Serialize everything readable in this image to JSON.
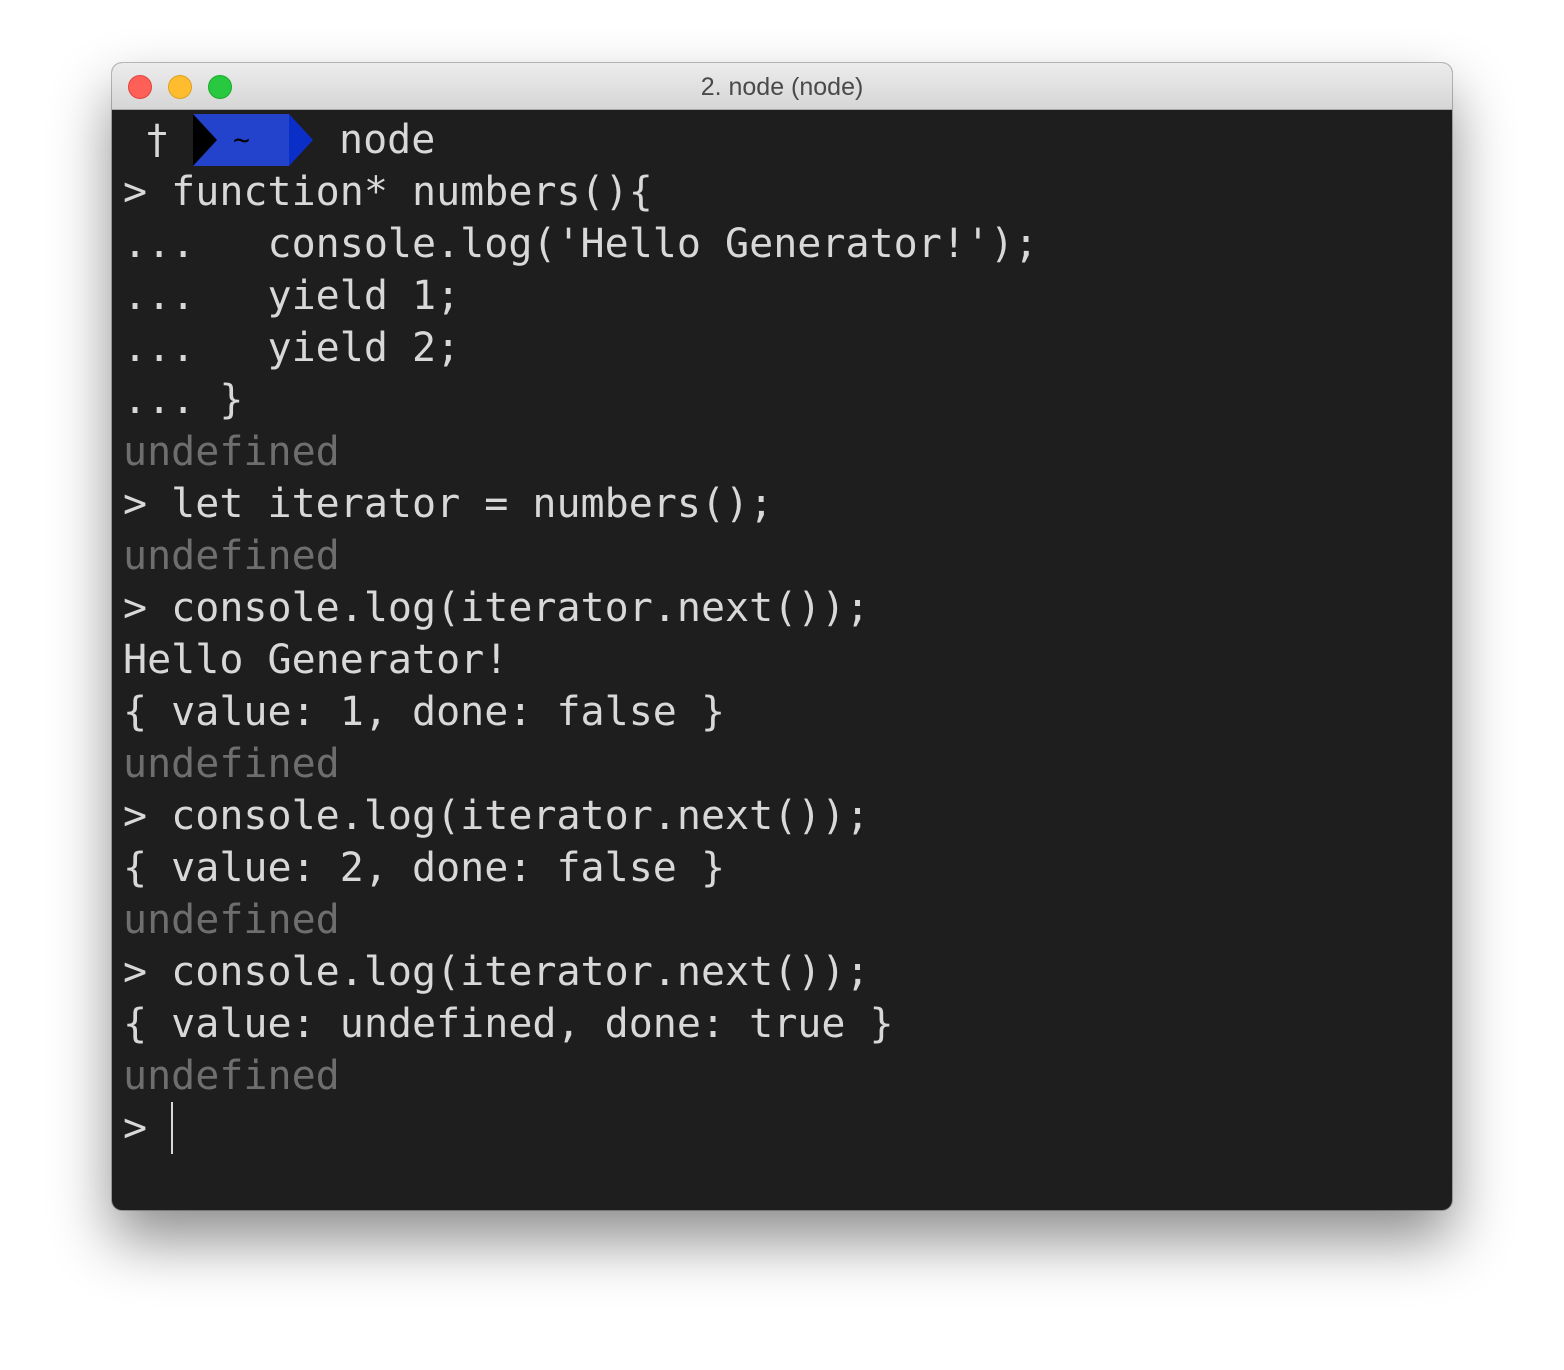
{
  "window": {
    "title": "2. node (node)"
  },
  "prompt": {
    "marker": "†",
    "dir": "~",
    "command": "node"
  },
  "colors": {
    "segment": "#2443cc",
    "segment_arrow": "#0a2fc8",
    "text": "#d8d8d8",
    "dim": "#6e6e6e",
    "background": "#1e1e1e"
  },
  "lines": [
    {
      "text": "> function* numbers(){",
      "dim": false
    },
    {
      "text": "...   console.log('Hello Generator!');",
      "dim": false
    },
    {
      "text": "...   yield 1;",
      "dim": false
    },
    {
      "text": "...   yield 2;",
      "dim": false
    },
    {
      "text": "... }",
      "dim": false
    },
    {
      "text": "undefined",
      "dim": true
    },
    {
      "text": "> let iterator = numbers();",
      "dim": false
    },
    {
      "text": "undefined",
      "dim": true
    },
    {
      "text": "> console.log(iterator.next());",
      "dim": false
    },
    {
      "text": "Hello Generator!",
      "dim": false
    },
    {
      "text": "{ value: 1, done: false }",
      "dim": false
    },
    {
      "text": "undefined",
      "dim": true
    },
    {
      "text": "> console.log(iterator.next());",
      "dim": false
    },
    {
      "text": "{ value: 2, done: false }",
      "dim": false
    },
    {
      "text": "undefined",
      "dim": true
    },
    {
      "text": "> console.log(iterator.next());",
      "dim": false
    },
    {
      "text": "{ value: undefined, done: true }",
      "dim": false
    },
    {
      "text": "undefined",
      "dim": true
    }
  ],
  "input": {
    "prompt": "> ",
    "value": ""
  }
}
